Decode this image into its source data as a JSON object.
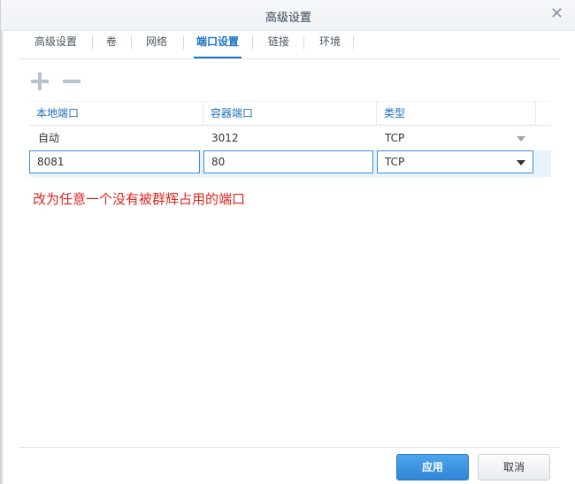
{
  "dialog": {
    "title": "高级设置"
  },
  "tabs": [
    {
      "label": "高级设置",
      "active": false
    },
    {
      "label": "卷",
      "active": false
    },
    {
      "label": "网络",
      "active": false
    },
    {
      "label": "端口设置",
      "active": true
    },
    {
      "label": "链接",
      "active": false
    },
    {
      "label": "环境",
      "active": false
    }
  ],
  "toolbar": {
    "add_icon": "plus-icon",
    "remove_icon": "minus-icon"
  },
  "table": {
    "headers": [
      "本地端口",
      "容器端口",
      "类型"
    ],
    "rows": [
      {
        "local_port": "自动",
        "container_port": "3012",
        "type": "TCP"
      },
      {
        "local_port": "8081",
        "container_port": "80",
        "type": "TCP"
      }
    ]
  },
  "annotation": "改为任意一个没有被群辉占用的端口",
  "footer": {
    "apply_label": "应用",
    "cancel_label": "取消"
  },
  "colors": {
    "accent": "#1a73c8",
    "annotation": "#e0231e",
    "primary_button": "#3a90dc"
  }
}
